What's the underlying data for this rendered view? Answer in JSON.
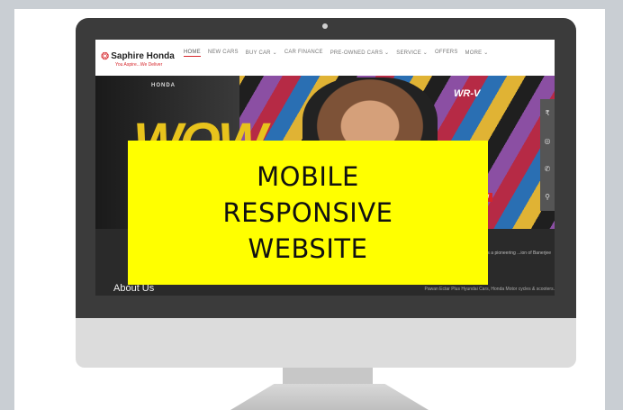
{
  "site": {
    "brand": "Saphire Honda",
    "tagline": "You Aspire...We Deliver",
    "menu": [
      "HOME",
      "NEW CARS",
      "BUY CAR ⌄",
      "CAR FINANCE",
      "PRE-OWNED CARS ⌄",
      "SERVICE ⌄",
      "OFFERS",
      "MORE ⌄"
    ],
    "hero": {
      "honda_label": "HONDA",
      "model_label": "WR-V",
      "wow_text": "WOW",
      "cta_text": "OW"
    },
    "rail_icons": [
      "rupee-icon",
      "steering-icon",
      "phone-icon",
      "location-pin-icon"
    ],
    "rail_glyphs": [
      "₹",
      "◎",
      "✆",
      "⚲"
    ],
    "about_title": "About Us",
    "para1": "...is a pioneering ...ion of Banerjee",
    "para2": "Pawan Ectar Plus Hyundai Cars, Honda Motor cycles & scooters."
  },
  "overlay": {
    "lines": [
      "MOBILE",
      "RESPONSIVE",
      "WEBSITE"
    ],
    "color": "#ffff00"
  }
}
